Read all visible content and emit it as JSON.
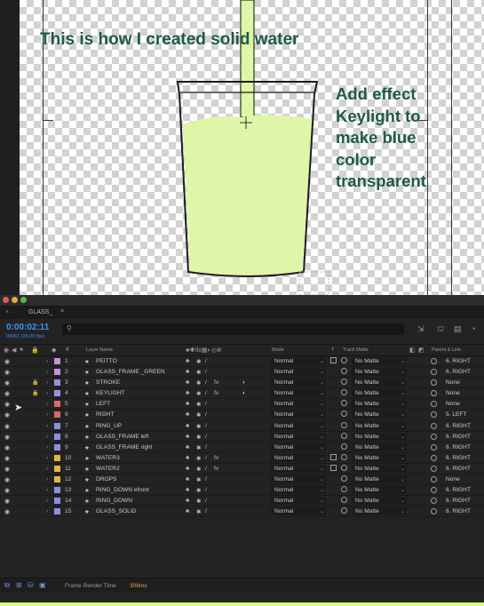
{
  "viewer": {
    "caption_main": "This is how I created solid water",
    "caption_side_lines": [
      "Add effect",
      "Keylight to",
      "make blue",
      "color",
      "transparent"
    ]
  },
  "panel": {
    "tab_name": "GLASS_",
    "tab_close_icon": "×",
    "tab_menu_icon": "≡",
    "timecode": "0:00:02:11",
    "frame_info": "00061 (25.00 fps)",
    "search_placeholder": ""
  },
  "columns": {
    "layer_name": "Layer Name",
    "mode": "Mode",
    "t": "T",
    "track_matte": "Track Matte",
    "parent_link": "Parent & Link"
  },
  "layers": [
    {
      "num": "1",
      "name": "PEITTO",
      "color": "#c98fd9",
      "lock": false,
      "fx": false,
      "motion_blur": false,
      "mode": "Normal",
      "track_icon": true,
      "track_matte": "No Matte",
      "parent": "6. RIGHT"
    },
    {
      "num": "2",
      "name": "GLASS_FRAME _GREEN",
      "color": "#c98fd9",
      "lock": false,
      "fx": false,
      "motion_blur": false,
      "mode": "Normal",
      "track_icon": false,
      "track_matte": "No Matte",
      "parent": "6. RIGHT"
    },
    {
      "num": "3",
      "name": "STROKE",
      "color": "#9d8fe0",
      "lock": true,
      "fx": true,
      "motion_blur": true,
      "mode": "Normal",
      "track_icon": false,
      "track_matte": "No Matte",
      "parent": "None"
    },
    {
      "num": "4",
      "name": "KEYLIGHT",
      "color": "#9d8fe0",
      "lock": true,
      "fx": true,
      "motion_blur": true,
      "mode": "Normal",
      "track_icon": false,
      "track_matte": "No Matte",
      "parent": "None"
    },
    {
      "num": "5",
      "name": "LEFT",
      "color": "#d96a6a",
      "lock": false,
      "fx": false,
      "motion_blur": false,
      "mode": "Normal",
      "track_icon": false,
      "track_matte": "No Matte",
      "parent": "None"
    },
    {
      "num": "6",
      "name": "RIGHT",
      "color": "#d96a6a",
      "lock": false,
      "fx": false,
      "motion_blur": false,
      "mode": "Normal",
      "track_icon": false,
      "track_matte": "No Matte",
      "parent": "5. LEFT"
    },
    {
      "num": "7",
      "name": "RING_UP",
      "color": "#8f8fe0",
      "lock": false,
      "fx": false,
      "motion_blur": false,
      "mode": "Normal",
      "track_icon": false,
      "track_matte": "No Matte",
      "parent": "6. RIGHT"
    },
    {
      "num": "8",
      "name": "GLASS_FRAME left",
      "color": "#8f8fe0",
      "lock": false,
      "fx": false,
      "motion_blur": false,
      "mode": "Normal",
      "track_icon": false,
      "track_matte": "No Matte",
      "parent": "6. RIGHT"
    },
    {
      "num": "9",
      "name": "GLASS_FRAME right",
      "color": "#8f8fe0",
      "lock": false,
      "fx": false,
      "motion_blur": false,
      "mode": "Normal",
      "track_icon": false,
      "track_matte": "No Matte",
      "parent": "6. RIGHT"
    },
    {
      "num": "10",
      "name": "WATER3",
      "color": "#e0b84a",
      "lock": false,
      "fx": true,
      "motion_blur": false,
      "mode": "Normal",
      "track_icon": true,
      "track_matte": "No Matte",
      "parent": "6. RIGHT"
    },
    {
      "num": "11",
      "name": "WATER2",
      "color": "#e0b84a",
      "lock": false,
      "fx": true,
      "motion_blur": false,
      "mode": "Normal",
      "track_icon": true,
      "track_matte": "No Matte",
      "parent": "6. RIGHT"
    },
    {
      "num": "12",
      "name": "DROPS",
      "color": "#e0b84a",
      "lock": false,
      "fx": false,
      "motion_blur": false,
      "mode": "Normal",
      "track_icon": false,
      "track_matte": "No Matte",
      "parent": "None"
    },
    {
      "num": "13",
      "name": "RING_DOWN efront",
      "color": "#8f8fe0",
      "lock": false,
      "fx": false,
      "motion_blur": false,
      "mode": "Normal",
      "track_icon": false,
      "track_matte": "No Matte",
      "parent": "6. RIGHT"
    },
    {
      "num": "14",
      "name": "RING_DOWN",
      "color": "#8f8fe0",
      "lock": false,
      "fx": false,
      "motion_blur": false,
      "mode": "Normal",
      "track_icon": false,
      "track_matte": "No Matte",
      "parent": "6. RIGHT"
    },
    {
      "num": "15",
      "name": "GLASS_SOLID",
      "color": "#8f8fe0",
      "lock": false,
      "fx": false,
      "motion_blur": false,
      "mode": "Normal",
      "track_icon": false,
      "track_matte": "No Matte",
      "parent": "6. RIGHT"
    }
  ],
  "footer": {
    "frame_render_label": "Frame Render Time",
    "frame_render_value": "308ms"
  },
  "colors": {
    "timecode": "#3d8ff1",
    "water_fill": "#dff5a8",
    "caption": "#1f5a44",
    "render_time": "#e0a94b"
  }
}
